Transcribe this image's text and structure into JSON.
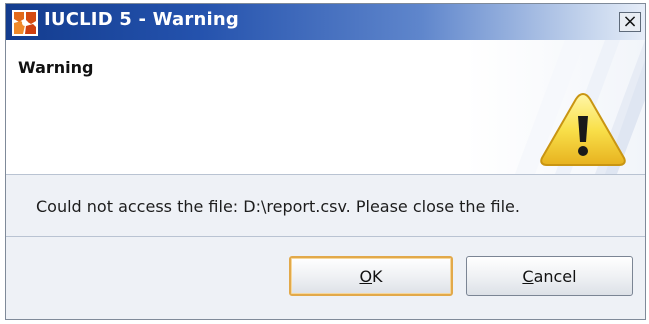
{
  "window": {
    "title": "IUCLID 5 - Warning",
    "close_symbol": "×"
  },
  "header": {
    "title": "Warning",
    "icon": "warning-triangle-icon"
  },
  "body": {
    "message": "Could not access the file: D:\\report.csv. Please close the file."
  },
  "buttons": {
    "ok": {
      "mnemonic": "O",
      "rest": "K"
    },
    "cancel": {
      "mnemonic": "C",
      "rest": "ancel"
    }
  },
  "colors": {
    "title_bar": "#2452ad",
    "default_button_border": "#e2a94a",
    "warning_fill": "#f7d93c"
  }
}
